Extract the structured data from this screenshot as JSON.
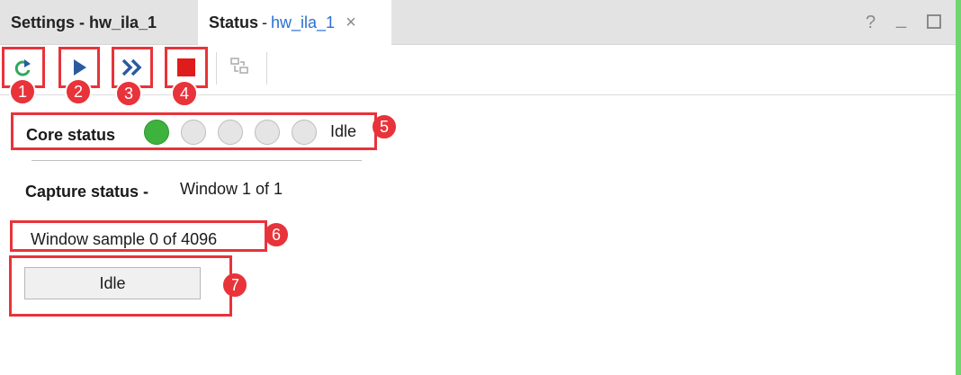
{
  "tabs": {
    "settings": {
      "label": "Settings - hw_ila_1"
    },
    "status": {
      "title": "Status",
      "separator": "-",
      "core": "hw_ila_1",
      "close": "×"
    }
  },
  "window_controls": {
    "help": "?",
    "minimize": "_"
  },
  "toolbar": {
    "buttons": [
      {
        "icon": "refresh-icon",
        "color": "#2fa85a"
      },
      {
        "icon": "run-trigger-icon",
        "color": "#2c5aa0"
      },
      {
        "icon": "run-trigger-immediate-icon",
        "color": "#2c5aa0"
      },
      {
        "icon": "stop-icon",
        "color": "#e01b1b"
      },
      {
        "icon": "auto-rearm-icon",
        "color": "#aaaaaa"
      }
    ]
  },
  "badges": [
    "1",
    "2",
    "3",
    "4",
    "5",
    "6",
    "7"
  ],
  "core_status": {
    "label": "Core status",
    "leds": [
      true,
      false,
      false,
      false,
      false
    ],
    "state": "Idle"
  },
  "capture_status": {
    "label": "Capture status -",
    "value": "Window 1 of 1"
  },
  "window_sample": "Window sample 0 of 4096",
  "status_field": "Idle",
  "colors": {
    "highlight": "#e8333a",
    "led_on": "#3db33d",
    "link": "#2a6fd6",
    "panel_edge": "#6fd66f"
  }
}
